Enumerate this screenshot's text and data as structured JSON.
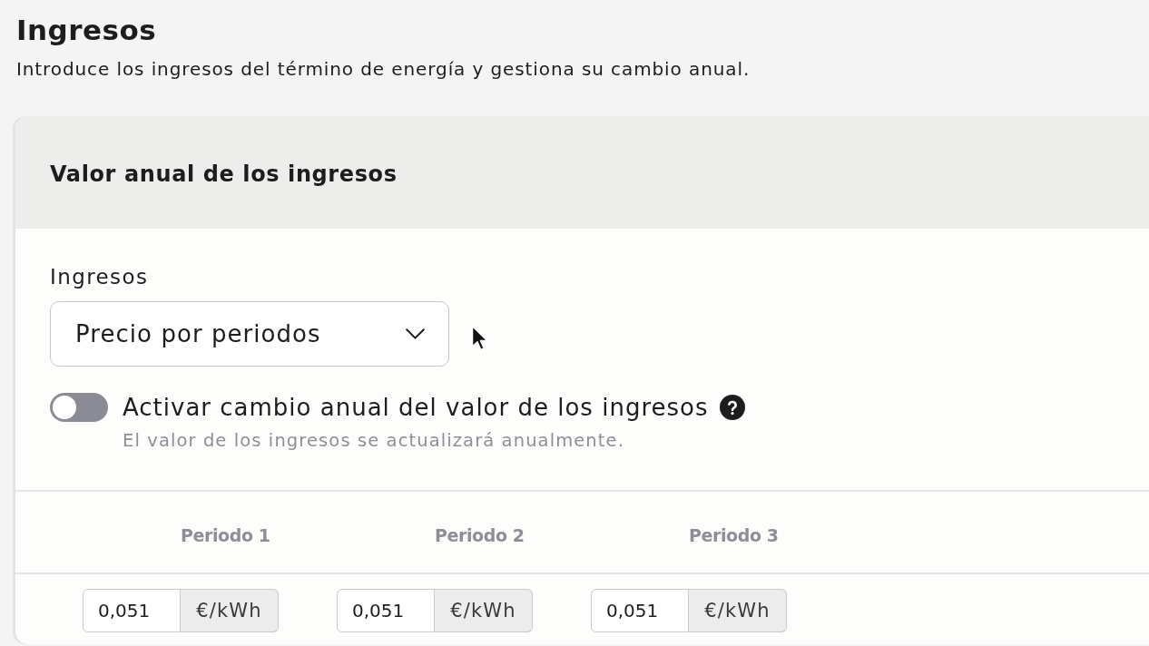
{
  "page": {
    "title": "Ingresos",
    "subtitle": "Introduce los ingresos del término de energía y gestiona su cambio anual."
  },
  "card": {
    "title": "Valor anual de los ingresos",
    "field": {
      "label": "Ingresos",
      "value": "Precio por periodos"
    },
    "toggle": {
      "label": "Activar cambio anual del valor de los ingresos",
      "on": false,
      "hint": "El valor de los ingresos se actualizará anualmente."
    },
    "table": {
      "columns": [
        "Periodo 1",
        "Periodo 2",
        "Periodo 3"
      ],
      "rows": [
        {
          "cells": [
            {
              "value": "0,051",
              "unit": "€/kWh"
            },
            {
              "value": "0,051",
              "unit": "€/kWh"
            },
            {
              "value": "0,051",
              "unit": "€/kWh"
            }
          ]
        }
      ]
    }
  }
}
